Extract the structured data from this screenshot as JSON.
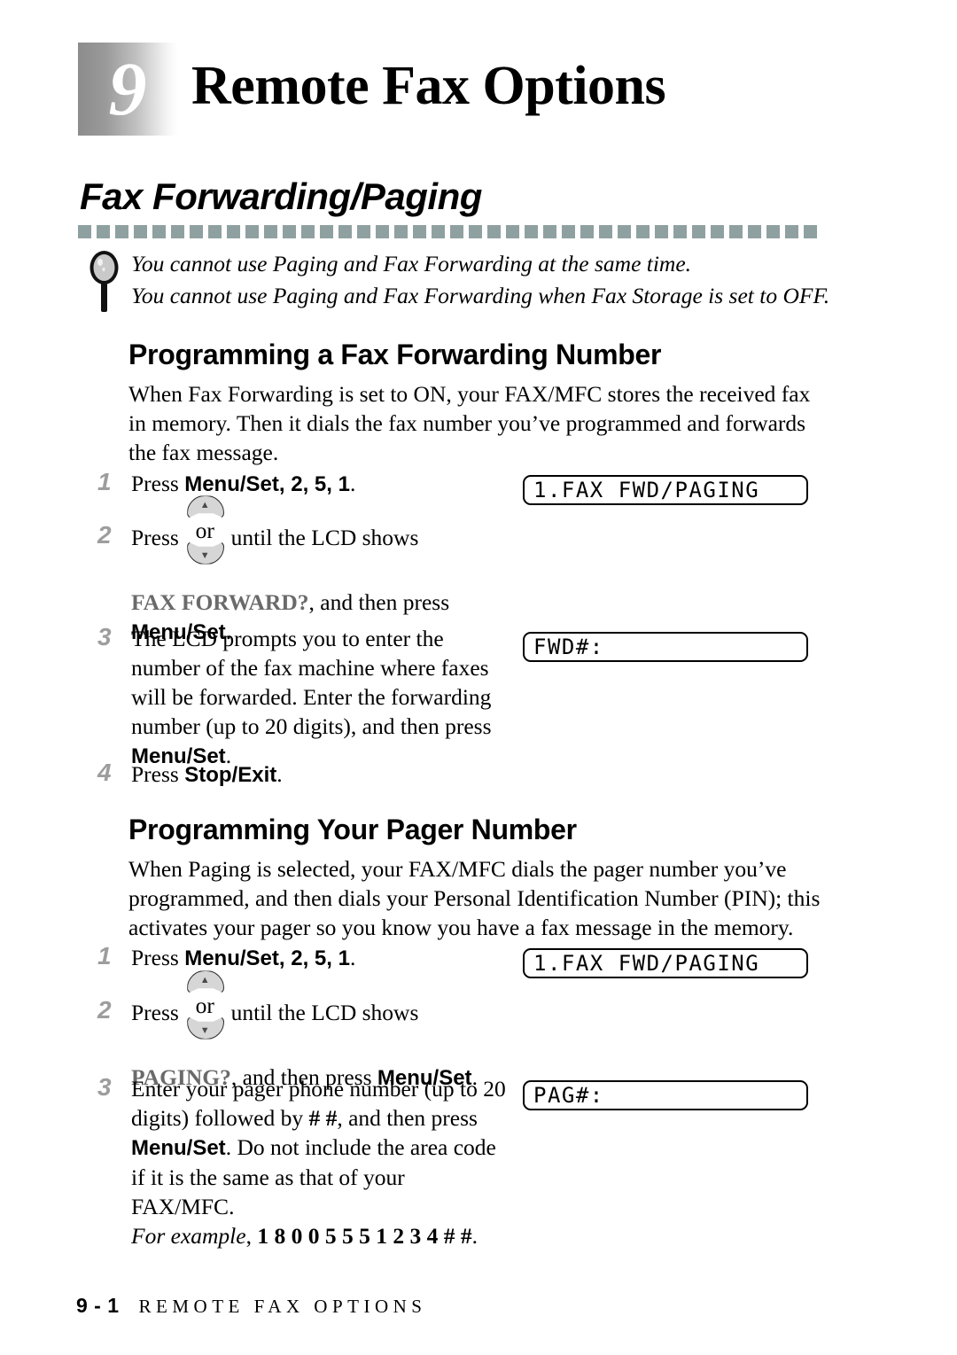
{
  "chapter": {
    "number": "9",
    "title": "Remote Fax Options"
  },
  "section": {
    "title": "Fax Forwarding/Paging",
    "note_icon": "magnifier-icon",
    "note_line1": "You cannot use Paging and Fax Forwarding at the same time.",
    "note_line2": "You cannot use Paging and Fax Forwarding when Fax Storage is set to OFF."
  },
  "fax_forwarding": {
    "heading": "Programming a Fax Forwarding Number",
    "intro": "When Fax Forwarding is set to ON, your FAX/MFC stores the received fax in memory. Then  it dials the fax number you’ve programmed and forwards the fax message.",
    "steps": {
      "one": {
        "num": "1",
        "press": "Press ",
        "key": "Menu/Set",
        "digits": ", 2, 5, 1",
        "period": "."
      },
      "two": {
        "num": "2",
        "press": "Press ",
        "or_label": "or",
        "up_arrow": "▲",
        "down_arrow": "▼",
        "after_key": " until the LCD shows",
        "lcd_word": "FAX FORWARD?",
        "then_press": ", and then press ",
        "key": "Menu/Set",
        "period": "."
      },
      "three": {
        "num": "3",
        "text": "The LCD prompts you to enter the number of the fax machine where faxes will be forwarded. Enter the forwarding number (up to 20 digits), and then press ",
        "key": "Menu/Set",
        "period": "."
      },
      "four": {
        "num": "4",
        "press": "Press ",
        "key": "Stop/Exit",
        "period": "."
      }
    },
    "lcd_1": "1.FAX FWD/PAGING",
    "lcd_2": "FWD#:"
  },
  "pager": {
    "heading": "Programming Your Pager Number",
    "intro": "When Paging is selected, your FAX/MFC dials the pager number you’ve programmed, and then dials your Personal Identification Number (PIN); this activates your pager so you know you have a fax message in the memory.",
    "steps": {
      "one": {
        "num": "1",
        "press": "Press ",
        "key": "Menu/Set",
        "digits": ", 2, 5, 1",
        "period": "."
      },
      "two": {
        "num": "2",
        "press": "Press ",
        "or_label": "or",
        "up_arrow": "▲",
        "down_arrow": "▼",
        "after_key": " until the LCD shows",
        "lcd_word": "PAGING?",
        "then_press": ", and then press ",
        "key": "Menu/Set",
        "period": "."
      },
      "three": {
        "num": "3",
        "text_a": "Enter your pager phone number (up to 20 digits) followed by ",
        "hash": "# #",
        "text_b": ", and then press ",
        "key": "Menu/Set",
        "text_c": ". Do not include the area code if it is the same as that of your FAX/MFC.",
        "example_label": "For example",
        "example_sep": ", ",
        "example_value": "1 8 0 0 5 5 5 1 2 3 4 # #",
        "period": "."
      }
    },
    "lcd_1": "1.FAX FWD/PAGING",
    "lcd_2": "PAG#:"
  },
  "footer": {
    "page": "9 - 1",
    "crumb": "REMOTE FAX OPTIONS"
  },
  "colors": {
    "rule": "#8fa0a0",
    "step_number": "#9d9d9d",
    "lcd_word": "#6a6a6a"
  }
}
